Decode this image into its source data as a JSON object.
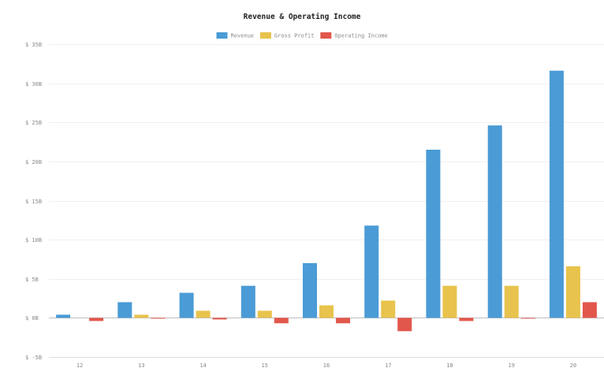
{
  "chart_data": {
    "type": "bar",
    "title": "Revenue & Operating Income",
    "xlabel": "",
    "ylabel": "",
    "legend_position": "top-center",
    "grid": true,
    "ylim": [
      -5,
      35
    ],
    "yticks": [
      -5,
      0,
      5,
      10,
      15,
      20,
      25,
      30,
      35
    ],
    "ytick_labels": [
      "$ -5B",
      "$ 0B",
      "$ 5B",
      "$ 10B",
      "$ 15B",
      "$ 20B",
      "$ 25B",
      "$ 30B",
      "$ 35B"
    ],
    "categories": [
      "12",
      "13",
      "14",
      "15",
      "16",
      "17",
      "18",
      "19",
      "20"
    ],
    "series": [
      {
        "name": "Revenue",
        "color": "#4a9bd6",
        "values": [
          0.4,
          2.0,
          3.2,
          4.1,
          7.0,
          11.8,
          21.5,
          24.6,
          31.6
        ]
      },
      {
        "name": "Gross Profit",
        "color": "#e8c34d",
        "values": [
          0.0,
          0.4,
          0.9,
          0.9,
          1.6,
          2.2,
          4.1,
          4.1,
          6.6
        ]
      },
      {
        "name": "Operating Income",
        "color": "#e2574c",
        "values": [
          -0.4,
          -0.1,
          -0.2,
          -0.7,
          -0.7,
          -1.7,
          -0.4,
          -0.05,
          2.0
        ]
      }
    ]
  }
}
